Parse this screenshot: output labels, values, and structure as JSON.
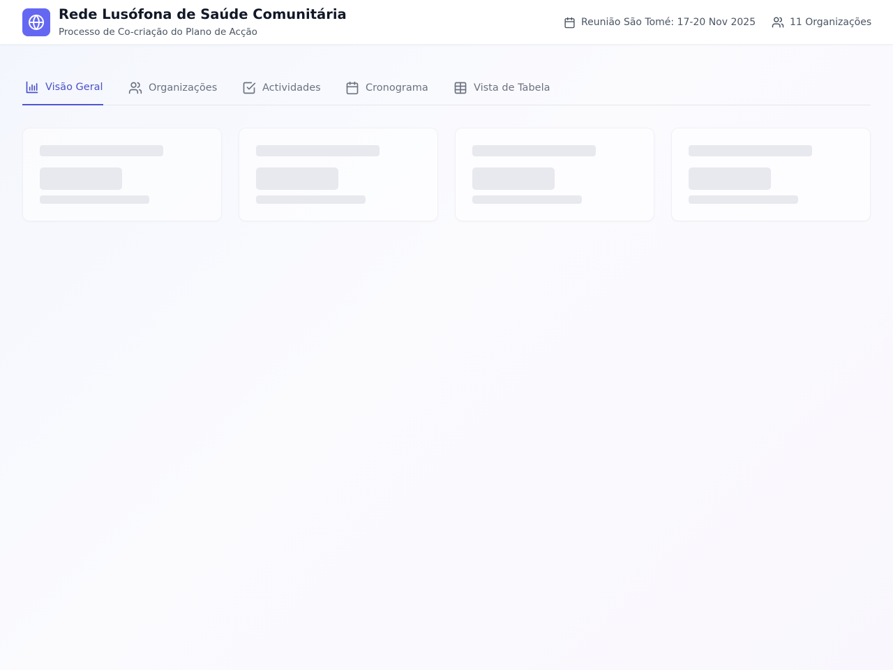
{
  "header": {
    "title": "Rede Lusófona de Saúde Comunitária",
    "subtitle": "Processo de Co-criação do Plano de Acção",
    "logo_icon": "globe-icon",
    "meeting": {
      "icon": "calendar-icon",
      "text": "Reunião São Tomé: 17-20 Nov 2025"
    },
    "organizations": {
      "icon": "users-icon",
      "text": "11 Organizações"
    }
  },
  "tabs": [
    {
      "label": "Visão Geral",
      "icon": "bar-chart-icon",
      "active": true
    },
    {
      "label": "Organizações",
      "icon": "users-icon",
      "active": false
    },
    {
      "label": "Actividades",
      "icon": "check-square-icon",
      "active": false
    },
    {
      "label": "Cronograma",
      "icon": "calendar-icon",
      "active": false
    },
    {
      "label": "Vista de Tabela",
      "icon": "table-icon",
      "active": false
    }
  ],
  "colors": {
    "accent": "#6467f2",
    "active_tab": "#4a50c8",
    "skeleton": "#e7e9ee"
  },
  "loading_cards_count": 4
}
